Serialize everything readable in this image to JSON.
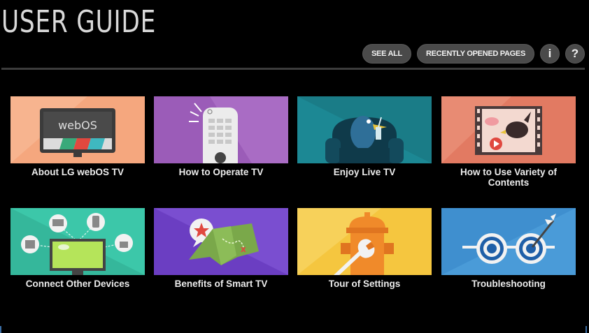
{
  "header": {
    "title": "USER GUIDE",
    "see_all_label": "SEE ALL",
    "recent_label": "RECENTLY OPENED PAGES",
    "info_label": "i",
    "help_label": "?"
  },
  "tiles": [
    {
      "label": "About LG webOS TV",
      "icon": "webos-tv-icon",
      "screen_text": "webOS",
      "color": "#f2a37b"
    },
    {
      "label": "How to Operate TV",
      "icon": "remote-control-icon",
      "color": "#9b59b6"
    },
    {
      "label": "Enjoy Live TV",
      "icon": "bird-on-couch-icon",
      "color": "#1f8b96"
    },
    {
      "label": "How to Use Variety of Contents",
      "icon": "film-strip-bird-icon",
      "color": "#e07a63"
    },
    {
      "label": "Connect Other Devices",
      "icon": "connected-devices-icon",
      "color": "#3cc6a8"
    },
    {
      "label": "Benefits of Smart TV",
      "icon": "treasure-map-icon",
      "color": "#6a3bc0"
    },
    {
      "label": "Tour of Settings",
      "icon": "hydrant-wrench-icon",
      "color": "#f4c842"
    },
    {
      "label": "Troubleshooting",
      "icon": "target-glasses-icon",
      "color": "#3f8fcf"
    }
  ]
}
